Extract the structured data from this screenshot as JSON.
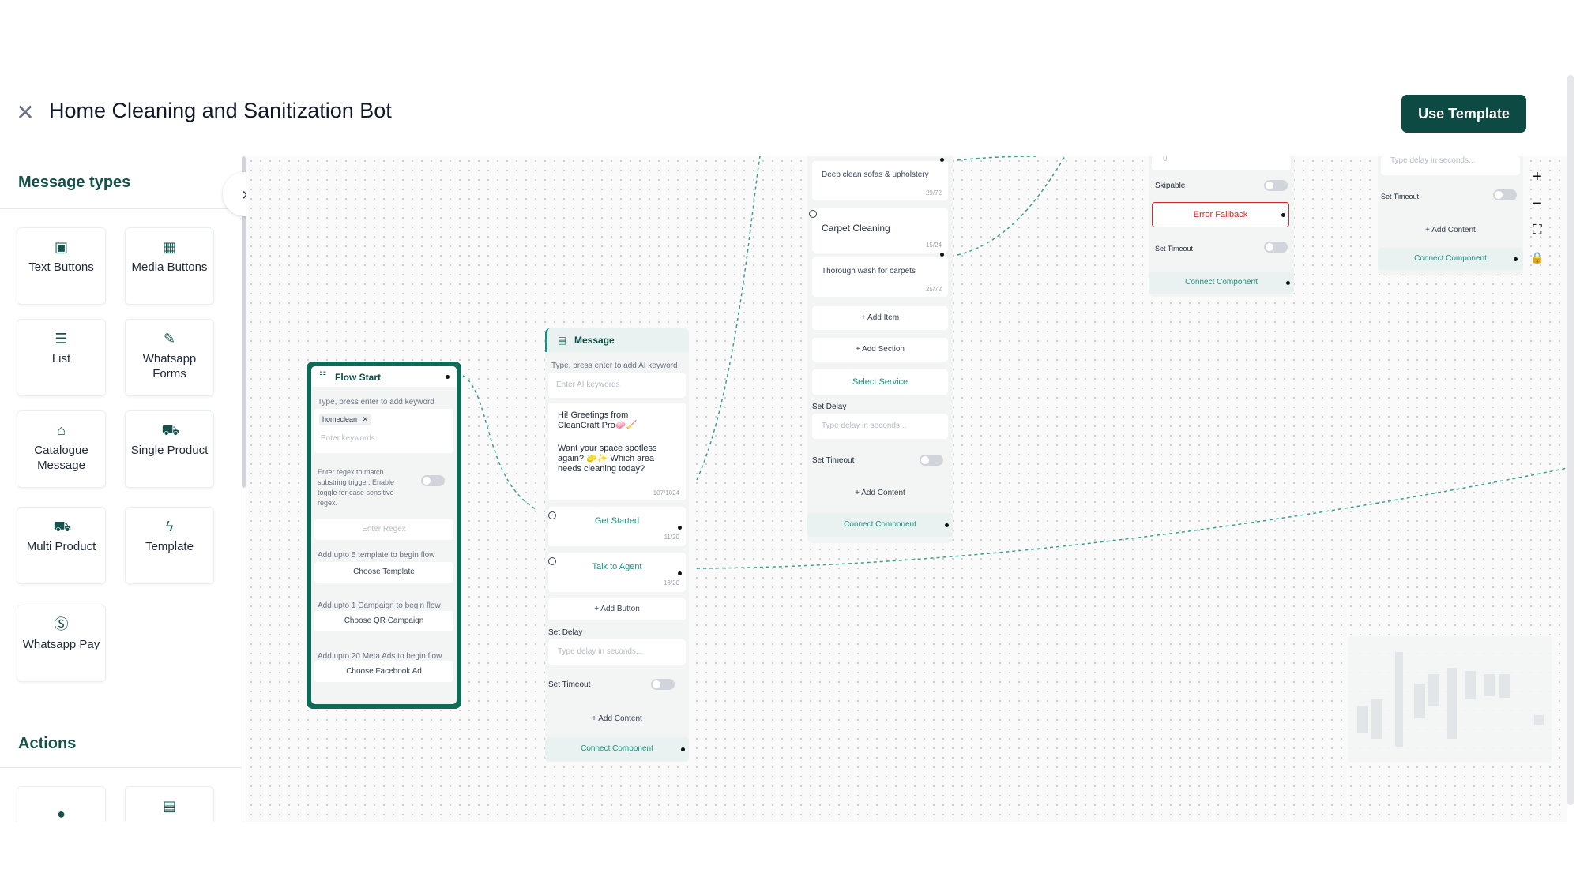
{
  "header": {
    "title": "Home Cleaning and Sanitization Bot",
    "use_template": "Use Template"
  },
  "sidebar": {
    "message_types_heading": "Message types",
    "tiles": [
      {
        "label": "Text Buttons",
        "icon": "text-buttons-icon"
      },
      {
        "label": "Media Buttons",
        "icon": "image-icon"
      },
      {
        "label": "List",
        "icon": "list-icon"
      },
      {
        "label": "Whatsapp Forms",
        "icon": "form-icon"
      },
      {
        "label": "Catalogue Message",
        "icon": "store-icon"
      },
      {
        "label": "Single Product",
        "icon": "cart-icon"
      },
      {
        "label": "Multi Product",
        "icon": "cart-multi-icon"
      },
      {
        "label": "Template",
        "icon": "bolt-icon"
      },
      {
        "label": "Whatsapp Pay",
        "icon": "pay-icon"
      }
    ],
    "actions_heading": "Actions"
  },
  "flow_start": {
    "header": "Flow Start",
    "keyword_hint": "Type, press enter to add keyword",
    "chip": "homeclean",
    "keywords_placeholder": "Enter keywords",
    "regex_desc": "Enter regex to match substring trigger. Enable toggle for case sensitive regex.",
    "regex_placeholder": "Enter Regex",
    "template_hint": "Add upto 5 template to begin flow",
    "choose_template": "Choose Template",
    "campaign_hint": "Add upto 1 Campaign to begin flow",
    "choose_qr": "Choose QR Campaign",
    "ads_hint": "Add upto 20 Meta Ads to begin flow",
    "choose_fb": "Choose Facebook Ad"
  },
  "message_node": {
    "header": "Message",
    "ai_hint": "Type, press enter to add AI keyword",
    "ai_placeholder": "Enter AI keywords",
    "body_line1": "Hi! Greetings from CleanCraft Pro🧼🧹",
    "body_line2": "Want your space spotless again? 🧽✨ Which area needs cleaning today?",
    "body_count": "107/1024",
    "btn1": "Get Started",
    "btn1_count": "11/20",
    "btn2": "Talk to Agent",
    "btn2_count": "13/20",
    "add_button": "+ Add Button",
    "set_delay": "Set Delay",
    "delay_placeholder": "Type delay in seconds...",
    "set_timeout": "Set Timeout",
    "add_content": "+ Add Content",
    "connect": "Connect Component"
  },
  "list_node": {
    "item1_desc": "Deep clean sofas & upholstery",
    "item1_count": "29/72",
    "item2_title": "Carpet Cleaning",
    "item2_count": "15/24",
    "item2_desc": "Thorough wash for carpets",
    "item2_desc_count": "25/72",
    "add_item": "+ Add Item",
    "add_section": "+ Add Section",
    "select_service": "Select Service",
    "set_delay": "Set Delay",
    "delay_placeholder": "Type delay in seconds...",
    "set_timeout": "Set Timeout",
    "add_content": "+ Add Content",
    "connect": "Connect Component"
  },
  "form_node": {
    "value": "0",
    "skipable": "Skipable",
    "error_fallback": "Error Fallback",
    "set_timeout": "Set Timeout",
    "connect": "Connect Component"
  },
  "right_node": {
    "delay_placeholder": "Type delay in seconds...",
    "set_timeout": "Set Timeout",
    "add_content": "+ Add Content",
    "connect": "Connect Component"
  },
  "controls": {
    "zoom_in": "+",
    "zoom_out": "−",
    "fit": "⛶",
    "lock": "🔒"
  },
  "colors": {
    "brand": "#0d4a43",
    "accent": "#1f8f7f",
    "error": "#dc2626"
  }
}
